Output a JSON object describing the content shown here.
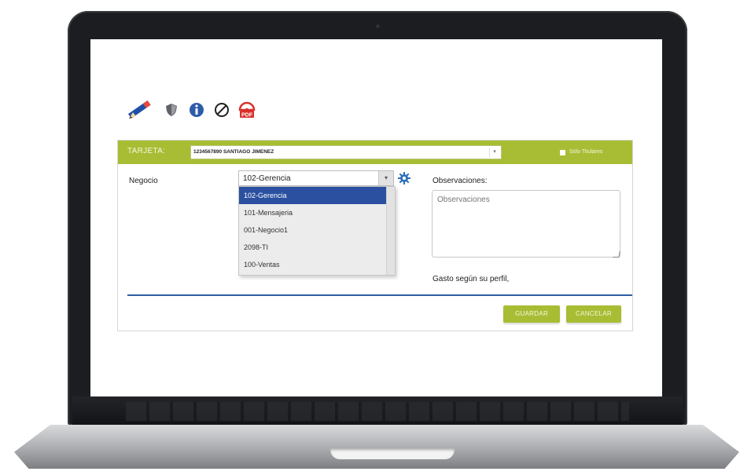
{
  "toolbar": {
    "icons": [
      "pencil-icon",
      "shield-icon",
      "info-icon",
      "prohibited-icon",
      "pdf-icon"
    ],
    "pdf_label": "PDF"
  },
  "card": {
    "label": "TARJETA:",
    "value": "1234567890 SANTIAGO JIMENEZ",
    "holders_only": "Sólo Titulares"
  },
  "business": {
    "label": "Negocio",
    "value": "102-Gerencia",
    "options": [
      "102-Gerencia",
      "101-Mensajeria",
      "001-Negocio1",
      "2098-TI",
      "100-Ventas"
    ],
    "selected_index": 0
  },
  "observations": {
    "label": "Observaciones:",
    "placeholder": "Observaciones"
  },
  "expense_note": "Gasto según su perfil,",
  "actions": {
    "save": "GUARDAR",
    "cancel": "CANCELAR"
  },
  "colors": {
    "accent_green": "#a8bd34",
    "selection_blue": "#2b50a0",
    "divider_blue": "#2d5ea3",
    "pdf_red": "#d9302a"
  }
}
